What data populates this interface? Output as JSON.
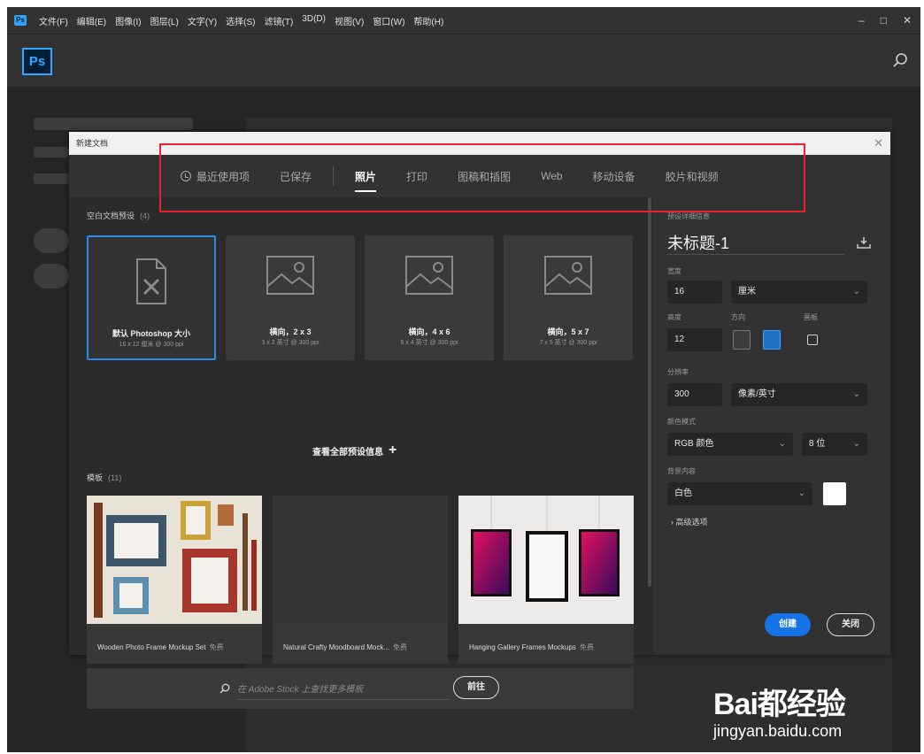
{
  "menubar": {
    "items": [
      "文件(F)",
      "编辑(E)",
      "图像(I)",
      "图层(L)",
      "文字(Y)",
      "选择(S)",
      "滤镜(T)",
      "3D(D)",
      "视图(V)",
      "窗口(W)",
      "帮助(H)"
    ],
    "minimize": "–",
    "restore": "□",
    "close": "✕"
  },
  "app": {
    "logo": "Ps",
    "search_icon": "search-icon"
  },
  "dialog": {
    "title": "新建文档",
    "close": "✕",
    "tabs": [
      {
        "label": "最近使用项",
        "icon": "clock-icon"
      },
      {
        "label": "已保存"
      },
      {
        "label": "照片",
        "active": true
      },
      {
        "label": "打印"
      },
      {
        "label": "图稿和插图"
      },
      {
        "label": "Web"
      },
      {
        "label": "移动设备"
      },
      {
        "label": "胶片和视频"
      }
    ],
    "blank_presets": {
      "label": "空白文档预设",
      "count": "(4)",
      "items": [
        {
          "name": "默认 Photoshop 大小",
          "desc": "16 x 12 厘米 @ 300 ppi",
          "icon": "document-icon"
        },
        {
          "name": "横向，2 x 3",
          "desc": "3 x 2 英寸 @ 300 ppi",
          "icon": "image-icon"
        },
        {
          "name": "横向，4 x 6",
          "desc": "6 x 4 英寸 @ 300 ppi",
          "icon": "image-icon"
        },
        {
          "name": "横向，5 x 7",
          "desc": "7 x 5 英寸 @ 300 ppi",
          "icon": "image-icon"
        }
      ]
    },
    "view_all": "查看全部预设信息",
    "templates": {
      "label": "模板",
      "count": "(11)",
      "items": [
        {
          "name": "Wooden Photo Frame Mockup Set",
          "badge": "免费"
        },
        {
          "name": "Natural Crafty Moodboard Mock...",
          "badge": "免费"
        },
        {
          "name": "Hanging Gallery Frames Mockups",
          "badge": "免费"
        }
      ]
    },
    "stock": {
      "placeholder": "在 Adobe Stock 上查找更多模板",
      "goto": "前往"
    }
  },
  "details": {
    "section_label": "预设详细信息",
    "doc_name": "未标题-1",
    "width_label": "宽度",
    "width_value": "16",
    "width_unit": "厘米",
    "height_label": "高度",
    "height_value": "12",
    "orientation_label": "方向",
    "artboard_label": "画板",
    "resolution_label": "分辨率",
    "resolution_value": "300",
    "resolution_unit": "像素/英寸",
    "color_mode_label": "颜色模式",
    "color_mode_value": "RGB 颜色",
    "bit_depth": "8 位",
    "background_label": "背景内容",
    "background_value": "白色",
    "background_color": "#ffffff",
    "advanced": "高级选项",
    "create": "创建",
    "close": "关闭"
  },
  "watermark": {
    "main": "Bai都经验",
    "sub": "jingyan.baidu.com"
  },
  "colors": {
    "accent": "#1473e6",
    "highlight": "#e8232f",
    "selected_border": "#2b8ae8"
  }
}
